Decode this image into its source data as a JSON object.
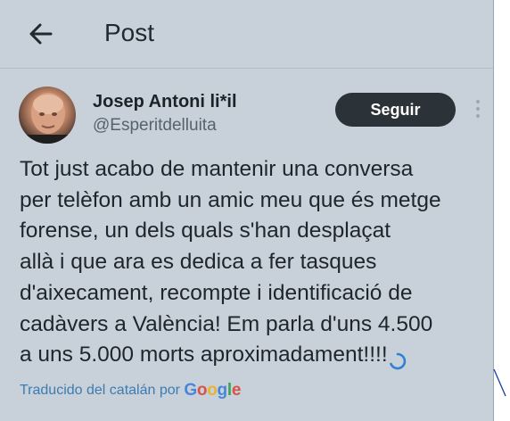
{
  "header": {
    "back_icon": "arrow-left-icon",
    "title": "Post"
  },
  "author": {
    "avatar_icon": "avatar",
    "name": "Josep Antoni li*il",
    "handle": "@Esperitdelluita",
    "follow_label": "Seguir",
    "more_icon": "more-vertical-icon"
  },
  "post": {
    "lines": [
      "Tot just acabo de mantenir una conversa",
      "per telèfon amb un amic meu que és metge",
      "forense, un dels quals s'han desplaçat",
      "allà i que ara es dedica a fer tasques",
      "d'aixecament, recompte i identificació de",
      "cadàvers a València! Em parla d'uns 4.500",
      "a uns 5.000 morts aproximadament!!!!"
    ],
    "loading_icon": "loading-spinner-icon"
  },
  "translation": {
    "label": "Traducido del catalán por",
    "provider_letters": [
      "G",
      "o",
      "o",
      "g",
      "l",
      "e"
    ]
  },
  "colors": {
    "background": "#c8d1d9",
    "text": "#1e262c",
    "follow_button": "#2b3338",
    "link": "#3d7cb0"
  }
}
